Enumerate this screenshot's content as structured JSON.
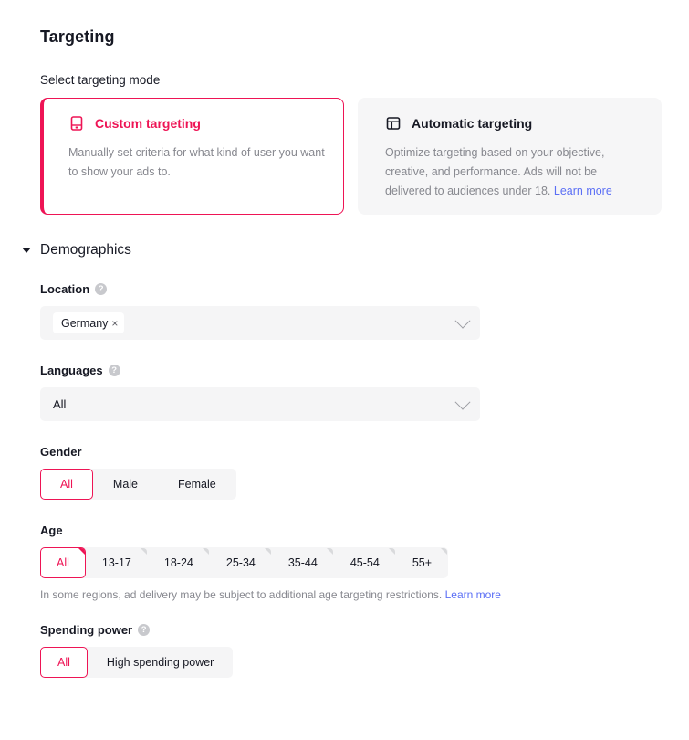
{
  "page": {
    "title": "Targeting",
    "mode_section_label": "Select targeting mode"
  },
  "targeting_modes": {
    "custom": {
      "icon": "device-card-icon",
      "title": "Custom targeting",
      "description": "Manually set criteria for what kind of user you want to show your ads to.",
      "selected": true
    },
    "automatic": {
      "icon": "layout-dashboard-icon",
      "title": "Automatic targeting",
      "description": "Optimize targeting based on your objective, creative, and performance. Ads will not be delivered to audiences under 18.",
      "link_label": "Learn more",
      "selected": false
    }
  },
  "demographics": {
    "section_title": "Demographics",
    "expanded": true,
    "location": {
      "label": "Location",
      "help": "?",
      "chips": [
        "Germany"
      ],
      "remove_glyph": "×"
    },
    "languages": {
      "label": "Languages",
      "help": "?",
      "value": "All"
    },
    "gender": {
      "label": "Gender",
      "options": [
        "All",
        "Male",
        "Female"
      ],
      "selected": "All"
    },
    "age": {
      "label": "Age",
      "options": [
        "All",
        "13-17",
        "18-24",
        "25-34",
        "35-44",
        "45-54",
        "55+"
      ],
      "selected": "All",
      "helper_text": "In some regions, ad delivery may be subject to additional age targeting restrictions.",
      "helper_link": "Learn more"
    },
    "spending_power": {
      "label": "Spending power",
      "help": "?",
      "options": [
        "All",
        "High spending power"
      ],
      "selected": "All"
    }
  },
  "colors": {
    "accent": "#ee1455",
    "link": "#5b6ff5",
    "muted_text": "#87888f",
    "field_bg": "#f5f5f6",
    "card_bg": "#f6f6f7"
  }
}
